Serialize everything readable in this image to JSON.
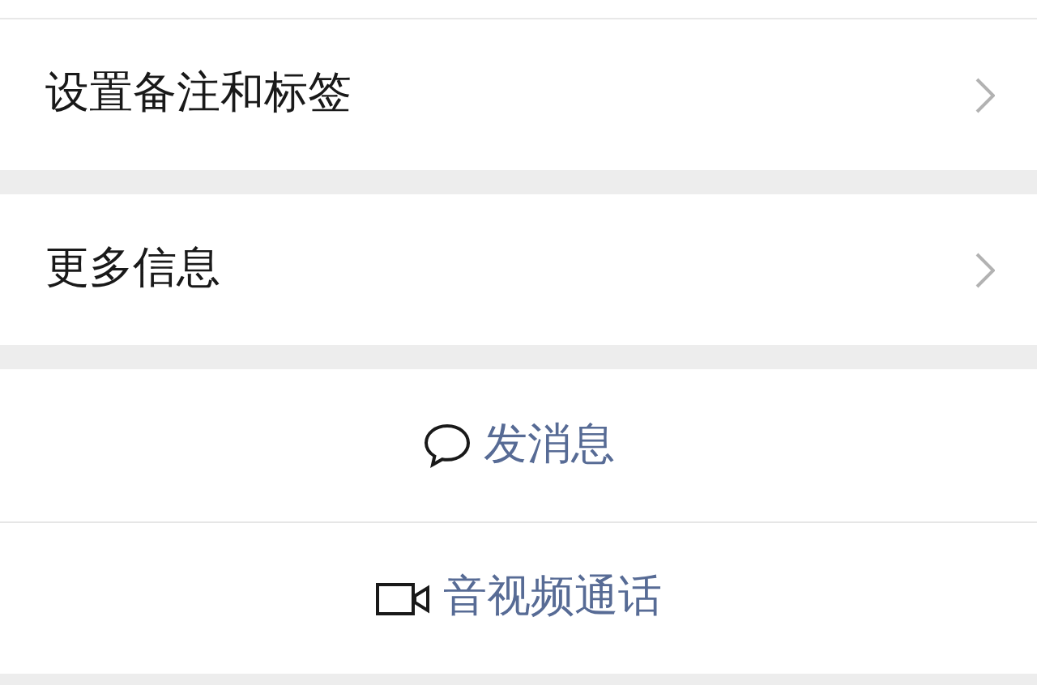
{
  "rows": [
    {
      "label": "设置备注和标签"
    },
    {
      "label": "更多信息"
    }
  ],
  "actions": [
    {
      "kind": "message",
      "label": "发消息"
    },
    {
      "kind": "video",
      "label": "音视频通话"
    }
  ]
}
